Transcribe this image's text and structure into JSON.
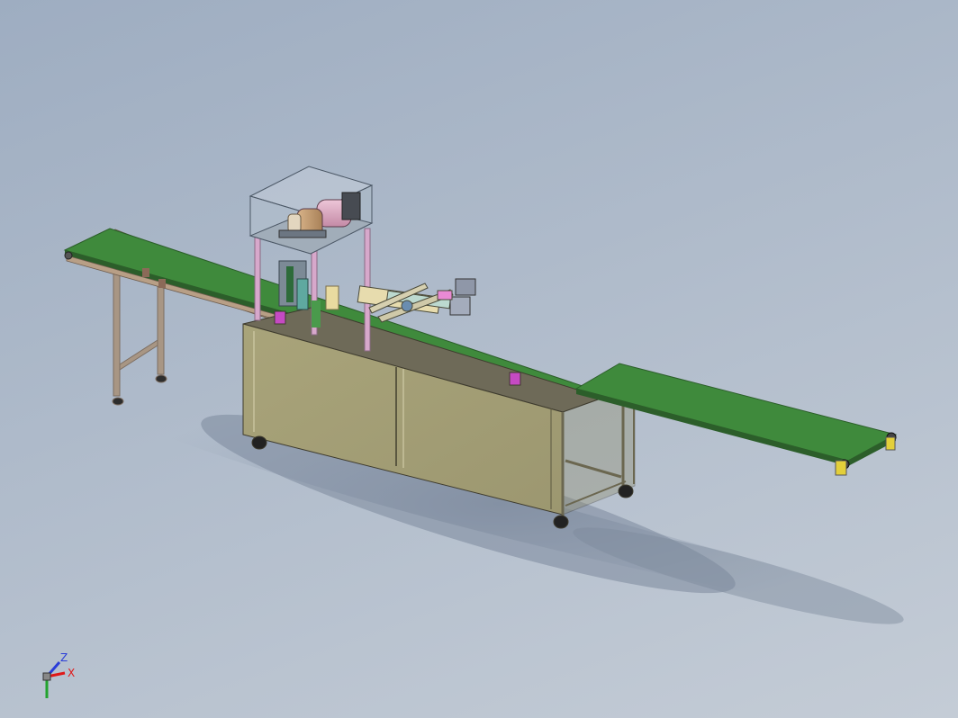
{
  "viewport": {
    "background_top": "#9eadc1",
    "background_bottom": "#c4ccd6"
  },
  "model": {
    "parts": [
      "left-infeed-conveyor",
      "right-outfeed-conveyor",
      "main-cabinet",
      "glass-guard-box",
      "motor",
      "gearbox",
      "pneumatic-cylinder-arm",
      "caster-wheels"
    ]
  },
  "colors": {
    "belt": "#3f8a3c",
    "belt_edge": "#2c5e2a",
    "cabinet": "#a7a278",
    "cabinet_top": "#6e6a58",
    "frame": "#b39a82",
    "legs": "#a89684",
    "motor": "#d9a8c0",
    "gearbox": "#c9a57c",
    "cylinder": "#e7dcae",
    "pink_post": "#d7a8cb",
    "magenta_tab": "#c54ac3",
    "wheel": "#222222",
    "axis_x": "#e01818",
    "axis_y": "#22a32e",
    "axis_z": "#2a3dd8"
  },
  "triad": {
    "x_label": "X",
    "y_label": "Y",
    "z_label": "Z"
  }
}
